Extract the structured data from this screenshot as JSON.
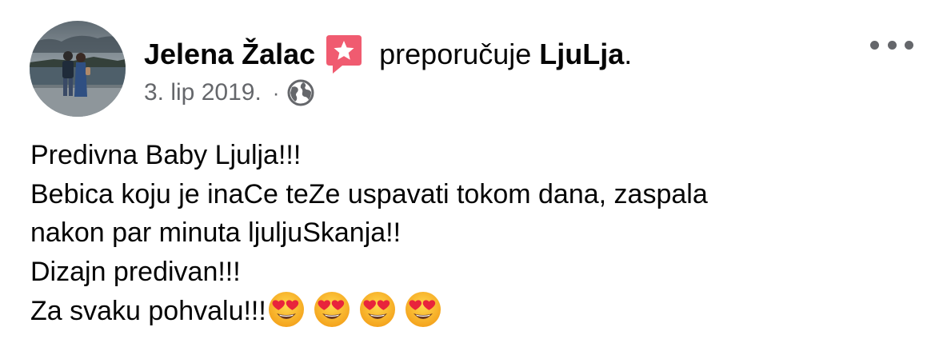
{
  "post": {
    "author": "Jelena Žalac",
    "action": "preporučuje",
    "page": "LjuLja",
    "period": ".",
    "date": "3. lip 2019.",
    "separator": "·",
    "audience_icon": "globe-icon",
    "recommend_icon": "recommendation-star-icon",
    "more_icon": "more-options-icon",
    "body_lines": [
      "Predivna Baby Ljulja!!!",
      "Bebica koju je inaCe teZe uspavati tokom dana, zaspala",
      "nakon par minuta ljuljuSkanja!!",
      "Dizajn predivan!!!",
      "Za svaku pohvalu!!!"
    ],
    "emojis": [
      "heart-eyes-emoji",
      "heart-eyes-emoji",
      "heart-eyes-emoji",
      "heart-eyes-emoji"
    ]
  },
  "colors": {
    "text": "#050505",
    "secondary_text": "#65676b",
    "recommend_badge": "#f05b70"
  }
}
